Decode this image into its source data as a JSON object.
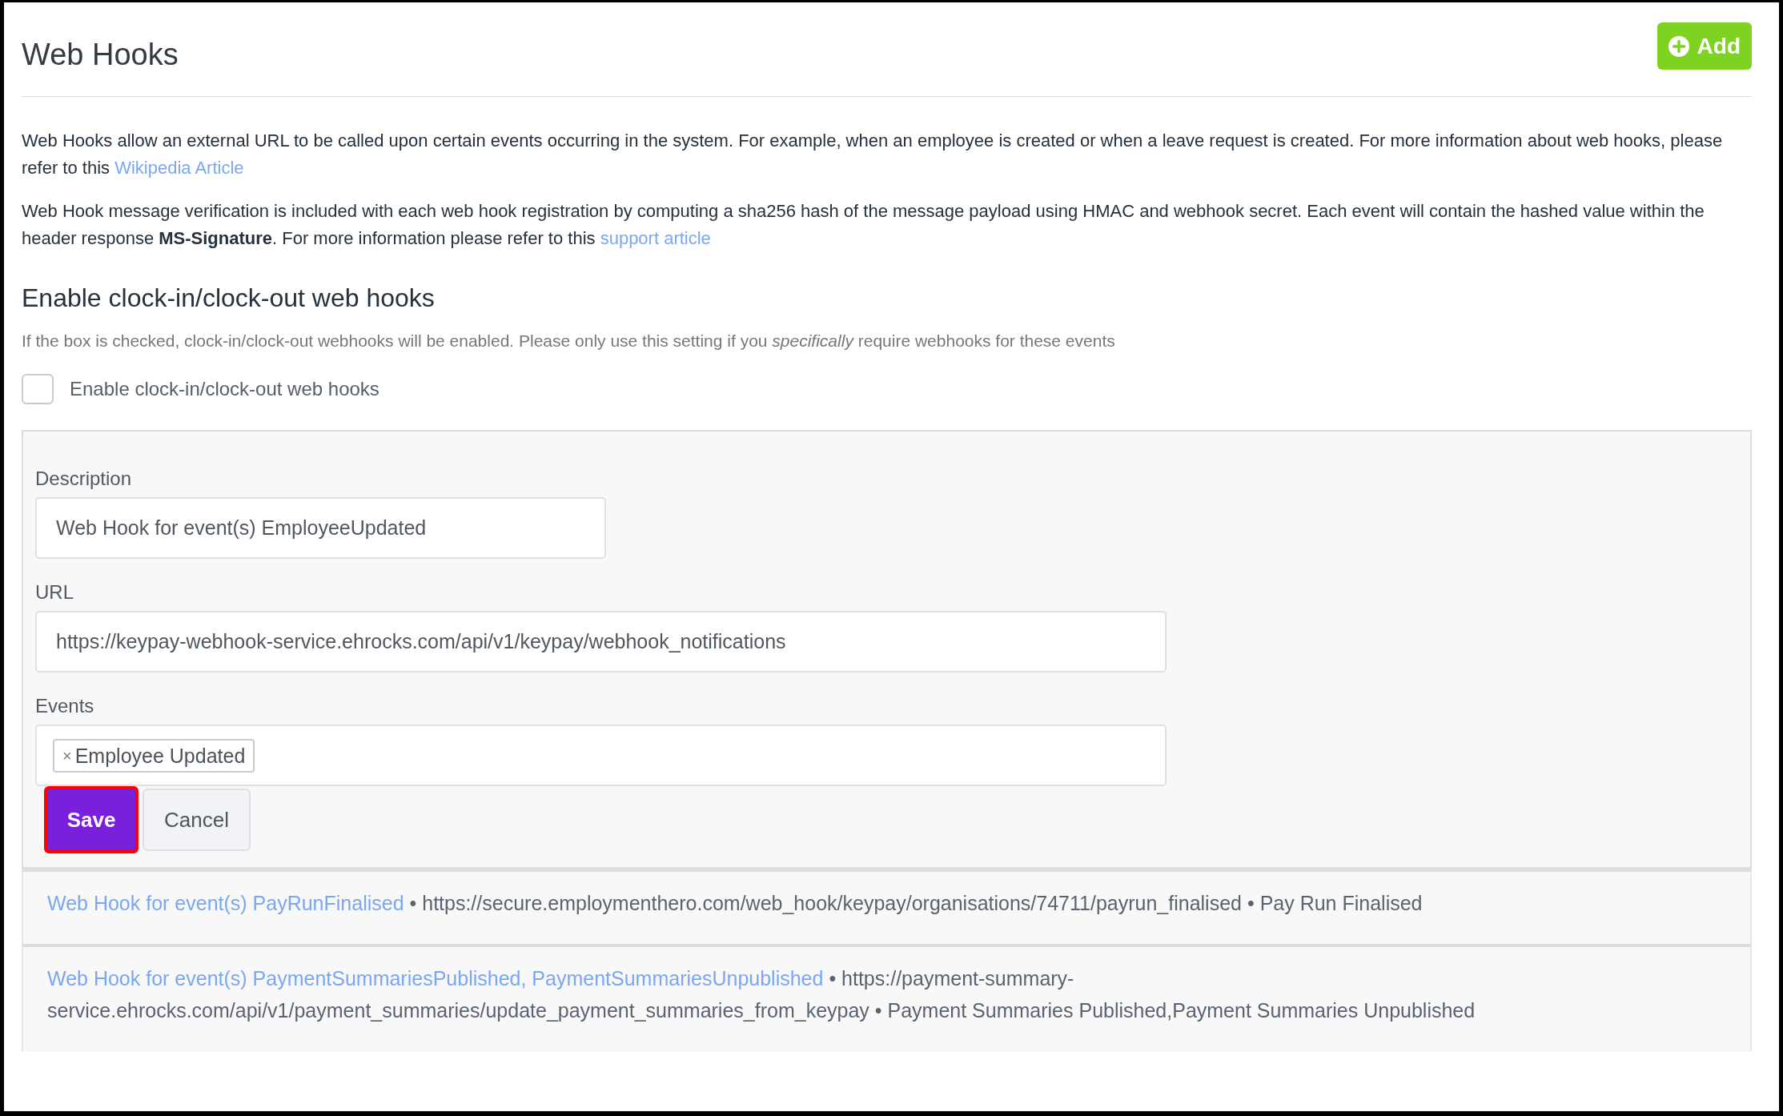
{
  "header": {
    "title": "Web Hooks",
    "add_button": "Add"
  },
  "paragraphs": [
    {
      "text": "Web Hooks allow an external URL to be called upon certain events occurring in the system. For example, when an employee is created or when a leave request is created. For more information about web hooks, please refer to this",
      "link": "Wikipedia Article"
    },
    {
      "text": "Web Hook message verification is included with each web hook registration by computing a sha256 hash of the message payload using HMAC and webhook secret. Each event will contain the hashed value within the header response **MS-Signature**. For more information please refer to this",
      "link": "support article"
    }
  ],
  "clock_section": {
    "heading": "Enable clock-in/clock-out web hooks",
    "hint": "If the box is checked, clock-in/clock-out webhooks will be enabled. Please only use this setting if you *specifically* require webhooks for these events",
    "checkbox": {
      "label": "Enable clock-in/clock-out web hooks",
      "checked": false
    }
  },
  "form": {
    "fields": [
      {
        "kind": "text",
        "label": "Description",
        "value": "Web Hook for event(s) EmployeeUpdated"
      },
      {
        "kind": "url",
        "label": "URL",
        "value": "https://keypay-webhook-service.ehrocks.com/api/v1/keypay/webhook_notifications"
      },
      {
        "kind": "tags",
        "label": "Events",
        "tags": [
          {
            "remove": "×",
            "label": "Employee Updated"
          }
        ]
      }
    ],
    "buttons": [
      {
        "kind": "primary",
        "label": "Save",
        "outlined": true
      },
      {
        "kind": "secondary",
        "label": "Cancel",
        "outlined": false
      }
    ]
  },
  "webhooks": [
    {
      "name": "Web Hook for event(s) PayRunFinalised",
      "url": "• https://secure.employmenthero.com/web_hook/keypay/organisations/74711/payrun_finalised",
      "events": "• Pay Run Finalised"
    },
    {
      "name": "Web Hook for event(s) PaymentSummariesPublished, PaymentSummariesUnpublished",
      "url": "• https://payment-summary-service.ehrocks.com/api/v1/payment_summaries/update_payment_summaries_from_keypay",
      "events": "• Payment Summaries Published,Payment Summaries Unpublished"
    }
  ]
}
